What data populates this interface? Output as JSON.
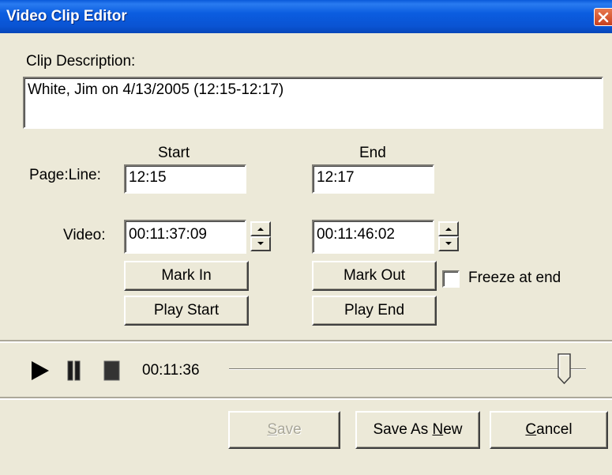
{
  "window": {
    "title": "Video Clip Editor"
  },
  "clip": {
    "description_label": "Clip Description:",
    "description_value": "White, Jim on 4/13/2005 (12:15-12:17)"
  },
  "columns": {
    "start": "Start",
    "end": "End"
  },
  "page_line": {
    "label": "Page:Line:",
    "start": "12:15",
    "end": "12:17"
  },
  "video": {
    "label": "Video:",
    "start": "00:11:37:09",
    "end": "00:11:46:02"
  },
  "buttons": {
    "mark_in": "Mark In",
    "mark_out": "Mark Out",
    "play_start": "Play Start",
    "play_end": "Play End",
    "save_accel": "S",
    "save_rest": "ave",
    "save_as_new_pre": "Save As ",
    "save_as_new_accel": "N",
    "save_as_new_post": "ew",
    "cancel_accel": "C",
    "cancel_rest": "ancel"
  },
  "freeze": {
    "label": "Freeze at end",
    "checked": false
  },
  "player": {
    "time": "00:11:36",
    "position_fraction": 0.94
  },
  "icons": {
    "close": "close-icon",
    "play": "play-icon",
    "pause": "pause-icon",
    "stop": "stop-icon",
    "spin_up": "spin-up-icon",
    "spin_down": "spin-down-icon"
  },
  "colors": {
    "title_bar": "#0a53d2",
    "face": "#ece9d8",
    "disabled_text": "#a9a799"
  }
}
